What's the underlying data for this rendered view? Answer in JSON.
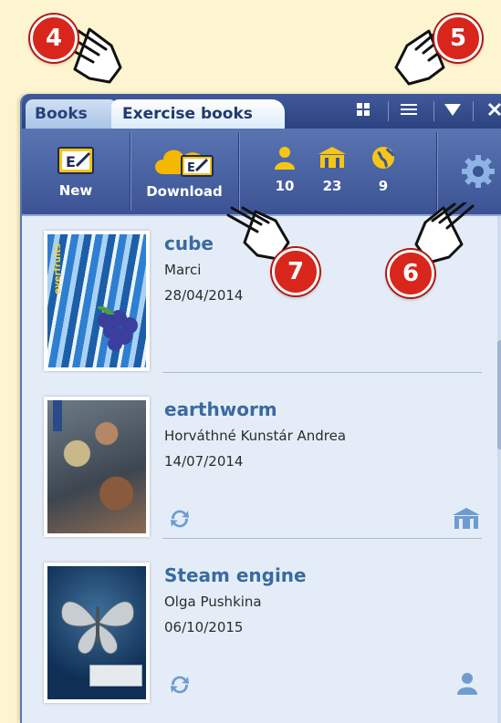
{
  "callouts": [
    {
      "number": "4"
    },
    {
      "number": "5"
    },
    {
      "number": "6"
    },
    {
      "number": "7"
    }
  ],
  "tabs": {
    "books": "Books",
    "exercise_books": "Exercise books"
  },
  "tab_icons": [
    "grid-view-icon",
    "list-view-icon",
    "dropdown-icon",
    "close-icon"
  ],
  "toolbar": {
    "new_label": "New",
    "download_label": "Download",
    "stats": [
      {
        "icon": "person-icon",
        "value": "10"
      },
      {
        "icon": "school-icon",
        "value": "23"
      },
      {
        "icon": "globe-icon",
        "value": "9"
      }
    ],
    "settings_icon": "gear-icon"
  },
  "colors": {
    "accent": "#3a6aa0",
    "badge": "#d8261c",
    "toolbar": "#3b5394",
    "icon_yellow": "#f5c518"
  },
  "items": [
    {
      "title": "cube",
      "author": "Marci",
      "date": "28/04/2014",
      "cover_text": "everfruits",
      "sync": false,
      "scope": ""
    },
    {
      "title": "earthworm",
      "author": "Horváthné Kunstár Andrea",
      "date": "14/07/2014",
      "sync": true,
      "scope": "school-icon"
    },
    {
      "title": "Steam engine",
      "author": "Olga Pushkina",
      "date": "06/10/2015",
      "sync": true,
      "scope": "person-icon"
    }
  ]
}
